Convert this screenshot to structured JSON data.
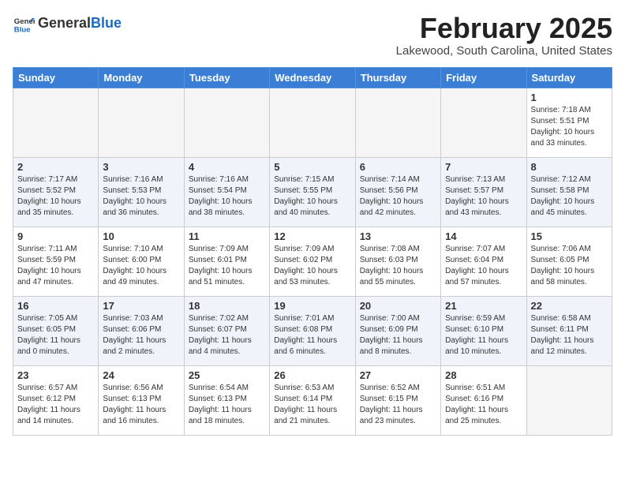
{
  "header": {
    "logo_general": "General",
    "logo_blue": "Blue",
    "month_title": "February 2025",
    "location": "Lakewood, South Carolina, United States"
  },
  "weekdays": [
    "Sunday",
    "Monday",
    "Tuesday",
    "Wednesday",
    "Thursday",
    "Friday",
    "Saturday"
  ],
  "weeks": [
    [
      {
        "day": "",
        "empty": true
      },
      {
        "day": "",
        "empty": true
      },
      {
        "day": "",
        "empty": true
      },
      {
        "day": "",
        "empty": true
      },
      {
        "day": "",
        "empty": true
      },
      {
        "day": "",
        "empty": true
      },
      {
        "day": "1",
        "sunrise": "7:18 AM",
        "sunset": "5:51 PM",
        "daylight": "10 hours and 33 minutes."
      }
    ],
    [
      {
        "day": "2",
        "sunrise": "7:17 AM",
        "sunset": "5:52 PM",
        "daylight": "10 hours and 35 minutes."
      },
      {
        "day": "3",
        "sunrise": "7:16 AM",
        "sunset": "5:53 PM",
        "daylight": "10 hours and 36 minutes."
      },
      {
        "day": "4",
        "sunrise": "7:16 AM",
        "sunset": "5:54 PM",
        "daylight": "10 hours and 38 minutes."
      },
      {
        "day": "5",
        "sunrise": "7:15 AM",
        "sunset": "5:55 PM",
        "daylight": "10 hours and 40 minutes."
      },
      {
        "day": "6",
        "sunrise": "7:14 AM",
        "sunset": "5:56 PM",
        "daylight": "10 hours and 42 minutes."
      },
      {
        "day": "7",
        "sunrise": "7:13 AM",
        "sunset": "5:57 PM",
        "daylight": "10 hours and 43 minutes."
      },
      {
        "day": "8",
        "sunrise": "7:12 AM",
        "sunset": "5:58 PM",
        "daylight": "10 hours and 45 minutes."
      }
    ],
    [
      {
        "day": "9",
        "sunrise": "7:11 AM",
        "sunset": "5:59 PM",
        "daylight": "10 hours and 47 minutes."
      },
      {
        "day": "10",
        "sunrise": "7:10 AM",
        "sunset": "6:00 PM",
        "daylight": "10 hours and 49 minutes."
      },
      {
        "day": "11",
        "sunrise": "7:09 AM",
        "sunset": "6:01 PM",
        "daylight": "10 hours and 51 minutes."
      },
      {
        "day": "12",
        "sunrise": "7:09 AM",
        "sunset": "6:02 PM",
        "daylight": "10 hours and 53 minutes."
      },
      {
        "day": "13",
        "sunrise": "7:08 AM",
        "sunset": "6:03 PM",
        "daylight": "10 hours and 55 minutes."
      },
      {
        "day": "14",
        "sunrise": "7:07 AM",
        "sunset": "6:04 PM",
        "daylight": "10 hours and 57 minutes."
      },
      {
        "day": "15",
        "sunrise": "7:06 AM",
        "sunset": "6:05 PM",
        "daylight": "10 hours and 58 minutes."
      }
    ],
    [
      {
        "day": "16",
        "sunrise": "7:05 AM",
        "sunset": "6:05 PM",
        "daylight": "11 hours and 0 minutes."
      },
      {
        "day": "17",
        "sunrise": "7:03 AM",
        "sunset": "6:06 PM",
        "daylight": "11 hours and 2 minutes."
      },
      {
        "day": "18",
        "sunrise": "7:02 AM",
        "sunset": "6:07 PM",
        "daylight": "11 hours and 4 minutes."
      },
      {
        "day": "19",
        "sunrise": "7:01 AM",
        "sunset": "6:08 PM",
        "daylight": "11 hours and 6 minutes."
      },
      {
        "day": "20",
        "sunrise": "7:00 AM",
        "sunset": "6:09 PM",
        "daylight": "11 hours and 8 minutes."
      },
      {
        "day": "21",
        "sunrise": "6:59 AM",
        "sunset": "6:10 PM",
        "daylight": "11 hours and 10 minutes."
      },
      {
        "day": "22",
        "sunrise": "6:58 AM",
        "sunset": "6:11 PM",
        "daylight": "11 hours and 12 minutes."
      }
    ],
    [
      {
        "day": "23",
        "sunrise": "6:57 AM",
        "sunset": "6:12 PM",
        "daylight": "11 hours and 14 minutes."
      },
      {
        "day": "24",
        "sunrise": "6:56 AM",
        "sunset": "6:13 PM",
        "daylight": "11 hours and 16 minutes."
      },
      {
        "day": "25",
        "sunrise": "6:54 AM",
        "sunset": "6:13 PM",
        "daylight": "11 hours and 18 minutes."
      },
      {
        "day": "26",
        "sunrise": "6:53 AM",
        "sunset": "6:14 PM",
        "daylight": "11 hours and 21 minutes."
      },
      {
        "day": "27",
        "sunrise": "6:52 AM",
        "sunset": "6:15 PM",
        "daylight": "11 hours and 23 minutes."
      },
      {
        "day": "28",
        "sunrise": "6:51 AM",
        "sunset": "6:16 PM",
        "daylight": "11 hours and 25 minutes."
      },
      {
        "day": "",
        "empty": true
      }
    ]
  ]
}
